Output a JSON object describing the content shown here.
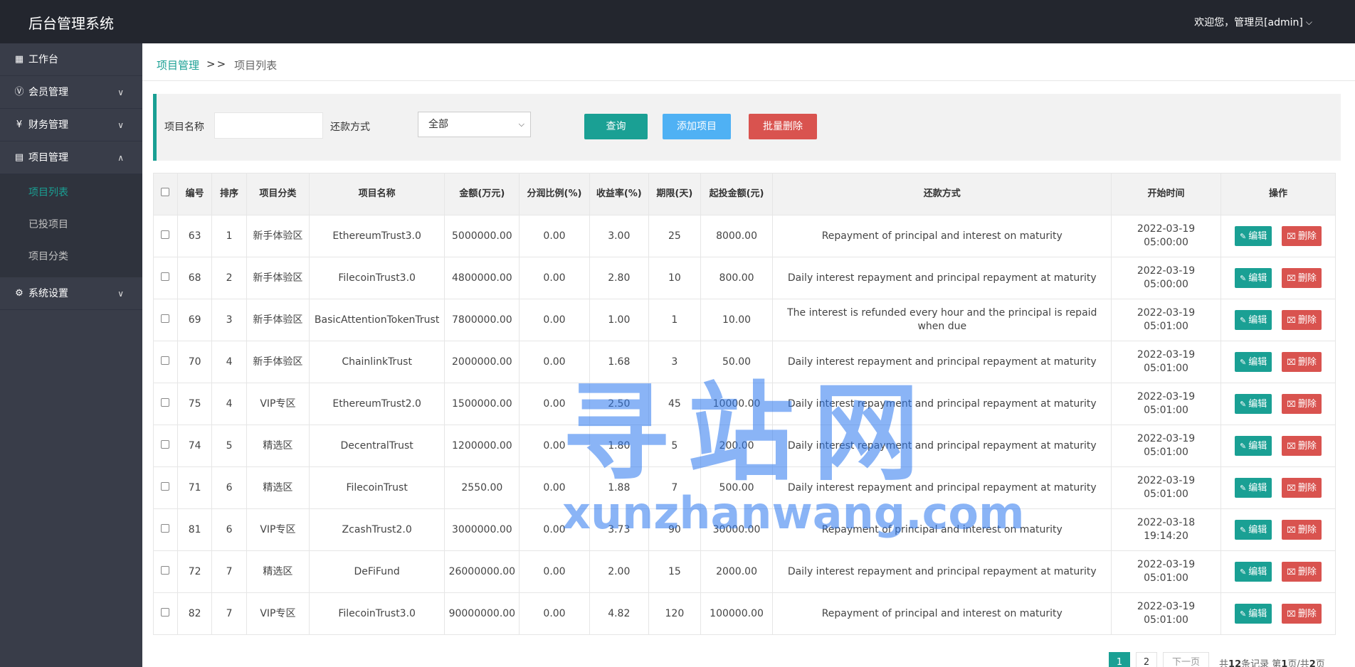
{
  "app": {
    "title": "后台管理系统",
    "user_label": "欢迎您，管理员[admin]"
  },
  "sidebar": {
    "items": [
      {
        "label": "工作台",
        "icon": "dashboard-icon"
      },
      {
        "label": "会员管理",
        "icon": "vip-icon"
      },
      {
        "label": "财务管理",
        "icon": "yen-icon"
      },
      {
        "label": "项目管理",
        "icon": "clipboard-icon"
      },
      {
        "label": "系统设置",
        "icon": "gear-icon"
      }
    ],
    "project_sub": [
      "项目列表",
      "已投项目",
      "项目分类"
    ]
  },
  "breadcrumb": {
    "parent": "项目管理",
    "separator": ">>",
    "current": "项目列表"
  },
  "filter": {
    "name_label": "项目名称",
    "name_value": "",
    "repay_label": "还款方式",
    "repay_selected": "全部",
    "query_label": "查询",
    "add_label": "添加项目",
    "bulk_delete_label": "批量删除"
  },
  "table": {
    "headers": [
      "编号",
      "排序",
      "项目分类",
      "项目名称",
      "金额(万元)",
      "分润比例(%)",
      "收益率(%)",
      "期限(天)",
      "起投金额(元)",
      "还款方式",
      "开始时间",
      "操作"
    ],
    "edit_label": "编辑",
    "delete_label": "删除",
    "rows": [
      {
        "id": "63",
        "sort": "1",
        "category": "新手体验区",
        "name": "EthereumTrust3.0",
        "amount": "5000000.00",
        "share": "0.00",
        "rate": "3.00",
        "term": "25",
        "min": "8000.00",
        "repay": "Repayment of principal and interest on maturity",
        "date": "2022-03-19",
        "time": "05:00:00"
      },
      {
        "id": "68",
        "sort": "2",
        "category": "新手体验区",
        "name": "FilecoinTrust3.0",
        "amount": "4800000.00",
        "share": "0.00",
        "rate": "2.80",
        "term": "10",
        "min": "800.00",
        "repay": "Daily interest repayment and principal repayment at maturity",
        "date": "2022-03-19",
        "time": "05:00:00"
      },
      {
        "id": "69",
        "sort": "3",
        "category": "新手体验区",
        "name": "BasicAttentionTokenTrust",
        "amount": "7800000.00",
        "share": "0.00",
        "rate": "1.00",
        "term": "1",
        "min": "10.00",
        "repay": "The interest is refunded every hour and the principal is repaid when due",
        "date": "2022-03-19",
        "time": "05:01:00"
      },
      {
        "id": "70",
        "sort": "4",
        "category": "新手体验区",
        "name": "ChainlinkTrust",
        "amount": "2000000.00",
        "share": "0.00",
        "rate": "1.68",
        "term": "3",
        "min": "50.00",
        "repay": "Daily interest repayment and principal repayment at maturity",
        "date": "2022-03-19",
        "time": "05:01:00"
      },
      {
        "id": "75",
        "sort": "4",
        "category": "VIP专区",
        "name": "EthereumTrust2.0",
        "amount": "1500000.00",
        "share": "0.00",
        "rate": "2.50",
        "term": "45",
        "min": "10000.00",
        "repay": "Daily interest repayment and principal repayment at maturity",
        "date": "2022-03-19",
        "time": "05:01:00"
      },
      {
        "id": "74",
        "sort": "5",
        "category": "精选区",
        "name": "DecentralTrust",
        "amount": "1200000.00",
        "share": "0.00",
        "rate": "1.80",
        "term": "5",
        "min": "200.00",
        "repay": "Daily interest repayment and principal repayment at maturity",
        "date": "2022-03-19",
        "time": "05:01:00"
      },
      {
        "id": "71",
        "sort": "6",
        "category": "精选区",
        "name": "FilecoinTrust",
        "amount": "2550.00",
        "share": "0.00",
        "rate": "1.88",
        "term": "7",
        "min": "500.00",
        "repay": "Daily interest repayment and principal repayment at maturity",
        "date": "2022-03-19",
        "time": "05:01:00"
      },
      {
        "id": "81",
        "sort": "6",
        "category": "VIP专区",
        "name": "ZcashTrust2.0",
        "amount": "3000000.00",
        "share": "0.00",
        "rate": "3.73",
        "term": "90",
        "min": "30000.00",
        "repay": "Repayment of principal and interest on maturity",
        "date": "2022-03-18",
        "time": "19:14:20"
      },
      {
        "id": "72",
        "sort": "7",
        "category": "精选区",
        "name": "DeFiFund",
        "amount": "26000000.00",
        "share": "0.00",
        "rate": "2.00",
        "term": "15",
        "min": "2000.00",
        "repay": "Daily interest repayment and principal repayment at maturity",
        "date": "2022-03-19",
        "time": "05:01:00"
      },
      {
        "id": "82",
        "sort": "7",
        "category": "VIP专区",
        "name": "FilecoinTrust3.0",
        "amount": "90000000.00",
        "share": "0.00",
        "rate": "4.82",
        "term": "120",
        "min": "100000.00",
        "repay": "Repayment of principal and interest on maturity",
        "date": "2022-03-19",
        "time": "05:01:00"
      }
    ]
  },
  "pagination": {
    "pages": [
      "1",
      "2"
    ],
    "current": "1",
    "next_label": "下一页",
    "info_prefix": "共",
    "total_records": "12",
    "info_mid": "条记录 第",
    "current_page": "1",
    "info_mid2": "页/共",
    "total_pages": "2",
    "info_suffix": "页"
  },
  "watermark": {
    "cn": "寻站网",
    "en": "xunzhanwang.com"
  }
}
